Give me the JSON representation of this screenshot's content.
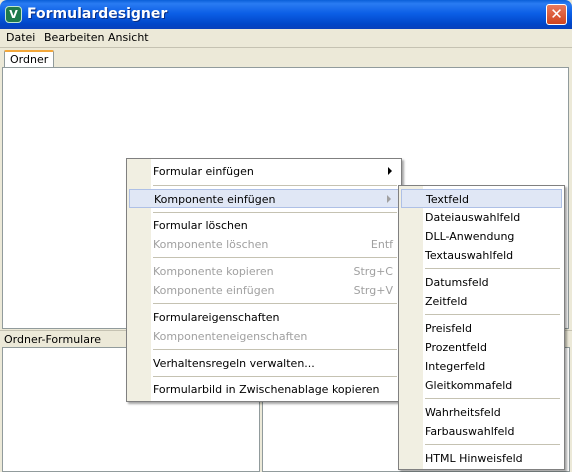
{
  "window": {
    "title": "Formulardesigner",
    "icon": "app-icon-v",
    "icon_glyph": "V",
    "close_glyph": "✕"
  },
  "menubar": [
    {
      "label": "Datei",
      "accel": "D"
    },
    {
      "label": "Bearbeiten",
      "accel": "B"
    },
    {
      "label": "Ansicht",
      "accel": "A"
    }
  ],
  "tab": {
    "label": "Ordner"
  },
  "subheader": {
    "label": "Ordner-Formulare"
  },
  "context_menu": {
    "items": [
      {
        "label": "Formular einfügen",
        "accel": "F",
        "submenu": true
      },
      {
        "label": "Komponente einfügen",
        "accel": "K",
        "submenu": true,
        "highlighted": true
      },
      {
        "label": "Formular löschen",
        "accel": "F"
      },
      {
        "label": "Komponente löschen",
        "shortcut": "Entf",
        "disabled": true
      },
      {
        "label": "Komponente kopieren",
        "shortcut": "Strg+C",
        "disabled": true
      },
      {
        "label": "Komponente einfügen",
        "shortcut": "Strg+V",
        "disabled": true
      },
      {
        "label": "Formulareigenschaften",
        "accel": "u"
      },
      {
        "label": "Komponenteneigenschaften",
        "disabled": true
      },
      {
        "label": "Verhaltensregeln verwalten...",
        "accel": "V"
      },
      {
        "label": "Formularbild in Zwischenablage kopieren",
        "accel": "F"
      }
    ]
  },
  "submenu": {
    "items": [
      {
        "label": "Textfeld",
        "accel": "T",
        "highlighted": true
      },
      {
        "label": "Dateiauswahlfeld",
        "accel": "D"
      },
      {
        "label": "DLL-Anwendung",
        "accel": "D"
      },
      {
        "label": "Textauswahlfeld",
        "accel": "x"
      },
      {
        "label": "Datumsfeld",
        "accel": "u"
      },
      {
        "label": "Zeitfeld",
        "accel": "Z"
      },
      {
        "label": "Preisfeld",
        "accel": "P"
      },
      {
        "label": "Prozentfeld",
        "accel": "P"
      },
      {
        "label": "Integerfeld",
        "accel": "I"
      },
      {
        "label": "Gleitkommafeld",
        "accel": "G"
      },
      {
        "label": "Wahrheitsfeld",
        "accel": "W"
      },
      {
        "label": "Farbauswahlfeld",
        "accel": "F"
      },
      {
        "label": "HTML Hinweisfeld",
        "accel": "H"
      }
    ]
  }
}
